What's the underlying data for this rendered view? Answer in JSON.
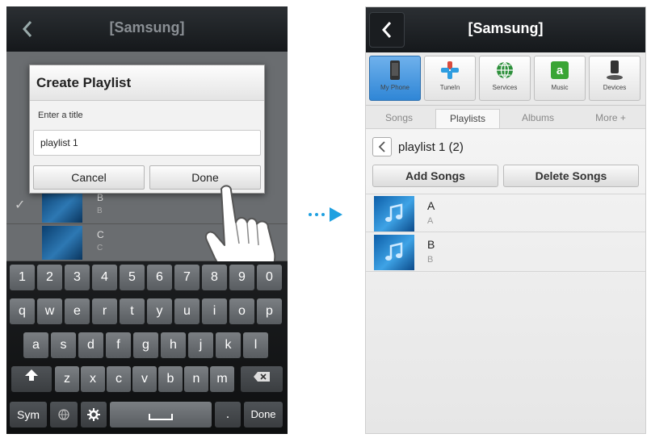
{
  "colors": {
    "accent": "#2f86d6",
    "arrow": "#1ea0e0"
  },
  "left": {
    "header": {
      "title": "[Samsung]"
    },
    "background_rows": [
      {
        "title": "B",
        "subtitle": "B"
      },
      {
        "title": "C",
        "subtitle": "C"
      }
    ],
    "dialog": {
      "title": "Create Playlist",
      "label": "Enter a title",
      "input_value": "playlist 1",
      "cancel_label": "Cancel",
      "done_label": "Done"
    },
    "keyboard": {
      "row_numbers": [
        "1",
        "2",
        "3",
        "4",
        "5",
        "6",
        "7",
        "8",
        "9",
        "0"
      ],
      "row1": [
        "q",
        "w",
        "e",
        "r",
        "t",
        "y",
        "u",
        "i",
        "o",
        "p"
      ],
      "row2": [
        "a",
        "s",
        "d",
        "f",
        "g",
        "h",
        "j",
        "k",
        "l"
      ],
      "row3": [
        "z",
        "x",
        "c",
        "v",
        "b",
        "n",
        "m"
      ],
      "sym_label": "Sym",
      "done_label": "Done",
      "period_label": "."
    }
  },
  "right": {
    "header": {
      "title": "[Samsung]"
    },
    "sources": [
      {
        "label": "My Phone",
        "icon": "phone-icon"
      },
      {
        "label": "TuneIn",
        "icon": "tunein-icon"
      },
      {
        "label": "Services",
        "icon": "globe-icon"
      },
      {
        "label": "Music",
        "icon": "amazon-icon"
      },
      {
        "label": "Devices",
        "icon": "speaker-icon"
      }
    ],
    "tabs": [
      "Songs",
      "Playlists",
      "Albums",
      "More +"
    ],
    "playlist_title": "playlist 1 (2)",
    "add_songs_label": "Add Songs",
    "delete_songs_label": "Delete Songs",
    "songs": [
      {
        "title": "A",
        "subtitle": "A"
      },
      {
        "title": "B",
        "subtitle": "B"
      }
    ]
  }
}
